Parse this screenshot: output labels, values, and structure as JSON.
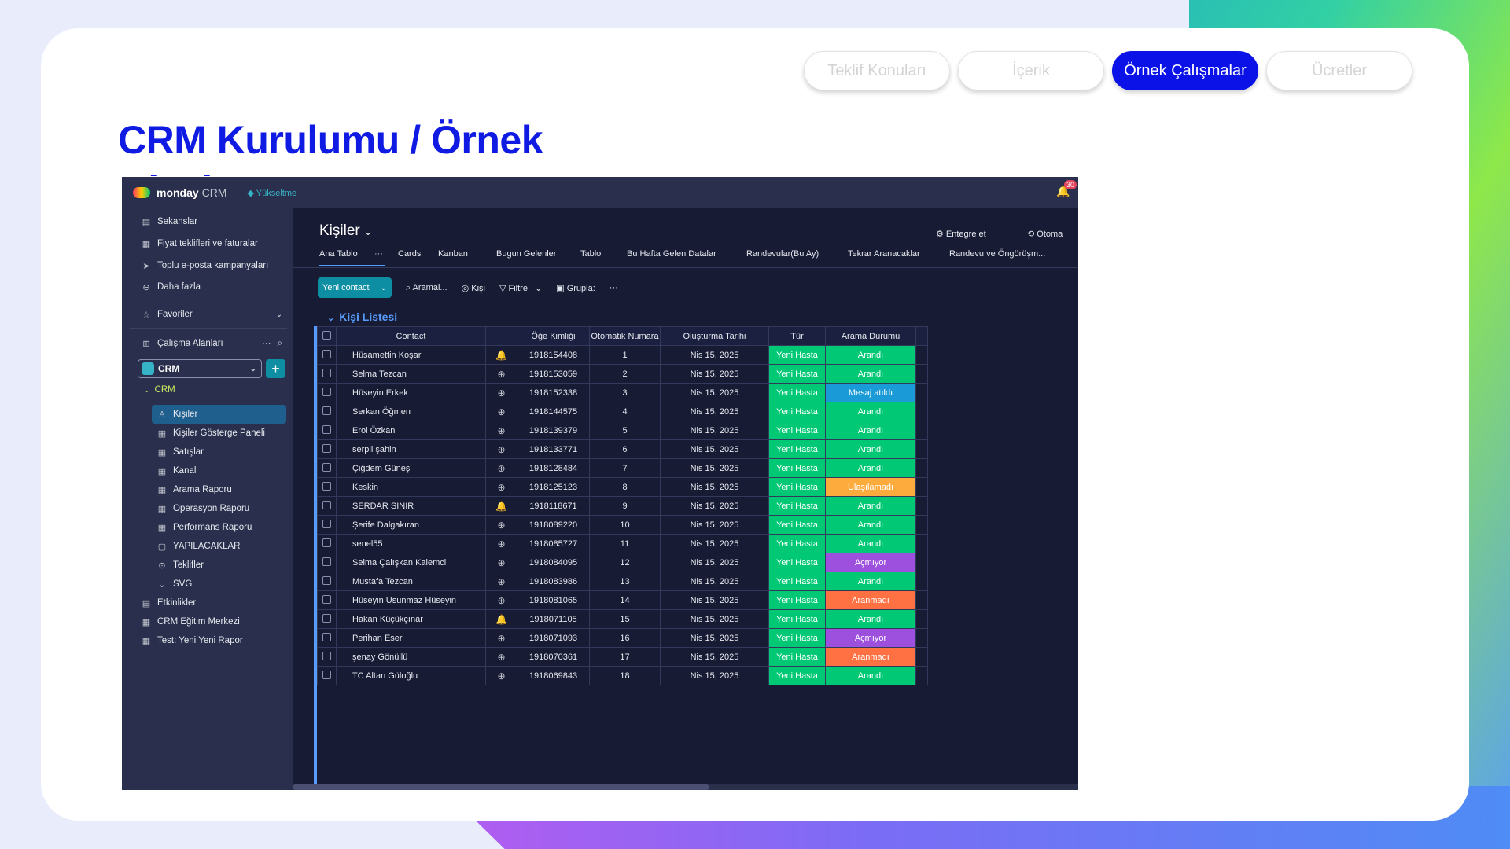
{
  "slide": {
    "title": "CRM Kurulumu / Örnek Olaylar",
    "nav": [
      "Teklif Konuları",
      "İçerik",
      "Örnek Çalışmalar",
      "Ücretler"
    ],
    "active_nav": "Örnek Çalışmalar"
  },
  "app": {
    "brand": "monday",
    "brand_suffix": "CRM",
    "upgrade": "Yükseltme",
    "notifications": "30",
    "sidebar": {
      "top_items": [
        {
          "label": "Sekanslar",
          "icon": "sequence-icon"
        },
        {
          "label": "Fiyat teklifleri ve faturalar",
          "icon": "invoice-icon"
        },
        {
          "label": "Toplu e-posta kampanyaları",
          "icon": "send-icon"
        },
        {
          "label": "Daha fazla",
          "icon": "more-circle-icon"
        }
      ],
      "favorites": "Favoriler",
      "workspaces": "Çalışma Alanları",
      "workspace": "CRM",
      "folder": "CRM",
      "boards": [
        "Kişiler",
        "Kişiler Gösterge Paneli",
        "Satışlar",
        "Kanal",
        "Arama Raporu",
        "Operasyon Raporu",
        "Performans Raporu",
        "YAPILACAKLAR",
        "Teklifler",
        "SVG"
      ],
      "bottom_items": [
        "Etkinlikler",
        "CRM Eğitim Merkezi",
        "Test: Yeni Yeni Rapor"
      ]
    },
    "board": {
      "title": "Kişiler",
      "integrate": "Entegre et",
      "automate": "Otoma",
      "tabs": [
        "Ana Tablo",
        "Cards",
        "Kanban",
        "Bugun Gelenler",
        "Tablo",
        "Bu Hafta Gelen Datalar",
        "Randevular(Bu Ay)",
        "Tekrar Aranacaklar",
        "Randevu ve Öngörüşm..."
      ],
      "toolbar": {
        "new": "Yeni contact",
        "search": "Aramal...",
        "person": "Kişi",
        "filter": "Filtre",
        "group": "Grupla:"
      },
      "group_name": "Kişi Listesi",
      "columns": [
        "Contact",
        "Öğe Kimliği",
        "Otomatik Numara",
        "Oluşturma Tarihi",
        "Tür",
        "Arama Durumu"
      ],
      "rows": [
        {
          "name": "Hüsamettin Koşar",
          "id": "1918154408",
          "num": "1",
          "date": "Nis 15, 2025",
          "type": "Yeni Hasta",
          "status": "Arandı",
          "color": "#00c875",
          "upd": "bell"
        },
        {
          "name": "Selma Tezcan",
          "id": "1918153059",
          "num": "2",
          "date": "Nis 15, 2025",
          "type": "Yeni Hasta",
          "status": "Arandı",
          "color": "#00c875",
          "upd": "plus"
        },
        {
          "name": "Hüseyin Erkek",
          "id": "1918152338",
          "num": "3",
          "date": "Nis 15, 2025",
          "type": "Yeni Hasta",
          "status": "Mesaj atıldı",
          "color": "#1a9ad6",
          "upd": "plus"
        },
        {
          "name": "Serkan Öğmen",
          "id": "1918144575",
          "num": "4",
          "date": "Nis 15, 2025",
          "type": "Yeni Hasta",
          "status": "Arandı",
          "color": "#00c875",
          "upd": "plus"
        },
        {
          "name": "Erol Özkan",
          "id": "1918139379",
          "num": "5",
          "date": "Nis 15, 2025",
          "type": "Yeni Hasta",
          "status": "Arandı",
          "color": "#00c875",
          "upd": "plus"
        },
        {
          "name": "serpil şahin",
          "id": "1918133771",
          "num": "6",
          "date": "Nis 15, 2025",
          "type": "Yeni Hasta",
          "status": "Arandı",
          "color": "#00c875",
          "upd": "plus"
        },
        {
          "name": "Çiğdem Güneş",
          "id": "1918128484",
          "num": "7",
          "date": "Nis 15, 2025",
          "type": "Yeni Hasta",
          "status": "Arandı",
          "color": "#00c875",
          "upd": "plus"
        },
        {
          "name": "Keskin",
          "id": "1918125123",
          "num": "8",
          "date": "Nis 15, 2025",
          "type": "Yeni Hasta",
          "status": "Ulaşılamadı",
          "color": "#fdab3d",
          "upd": "plus"
        },
        {
          "name": "SERDAR SINIR",
          "id": "1918118671",
          "num": "9",
          "date": "Nis 15, 2025",
          "type": "Yeni Hasta",
          "status": "Arandı",
          "color": "#00c875",
          "upd": "bell"
        },
        {
          "name": "Şerife Dalgakıran",
          "id": "1918089220",
          "num": "10",
          "date": "Nis 15, 2025",
          "type": "Yeni Hasta",
          "status": "Arandı",
          "color": "#00c875",
          "upd": "plus"
        },
        {
          "name": "senel55",
          "id": "1918085727",
          "num": "11",
          "date": "Nis 15, 2025",
          "type": "Yeni Hasta",
          "status": "Arandı",
          "color": "#00c875",
          "upd": "plus"
        },
        {
          "name": "Selma Çalışkan Kalemci",
          "id": "1918084095",
          "num": "12",
          "date": "Nis 15, 2025",
          "type": "Yeni Hasta",
          "status": "Açmıyor",
          "color": "#9d50dd",
          "upd": "plus"
        },
        {
          "name": "Mustafa Tezcan",
          "id": "1918083986",
          "num": "13",
          "date": "Nis 15, 2025",
          "type": "Yeni Hasta",
          "status": "Arandı",
          "color": "#00c875",
          "upd": "plus"
        },
        {
          "name": "Hüseyin Usunmaz Hüseyin",
          "id": "1918081065",
          "num": "14",
          "date": "Nis 15, 2025",
          "type": "Yeni Hasta",
          "status": "Aranmadı",
          "color": "#ff7043",
          "upd": "plus"
        },
        {
          "name": "Hakan Küçükçınar",
          "id": "1918071105",
          "num": "15",
          "date": "Nis 15, 2025",
          "type": "Yeni Hasta",
          "status": "Arandı",
          "color": "#00c875",
          "upd": "bell"
        },
        {
          "name": "Perihan Eser",
          "id": "1918071093",
          "num": "16",
          "date": "Nis 15, 2025",
          "type": "Yeni Hasta",
          "status": "Açmıyor",
          "color": "#9d50dd",
          "upd": "plus"
        },
        {
          "name": "şenay Gönüllü",
          "id": "1918070361",
          "num": "17",
          "date": "Nis 15, 2025",
          "type": "Yeni Hasta",
          "status": "Aranmadı",
          "color": "#ff7043",
          "upd": "plus"
        },
        {
          "name": "TC Altan Güloğlu",
          "id": "1918069843",
          "num": "18",
          "date": "Nis 15, 2025",
          "type": "Yeni Hasta",
          "status": "Arandı",
          "color": "#00c875",
          "upd": "plus"
        }
      ]
    }
  }
}
